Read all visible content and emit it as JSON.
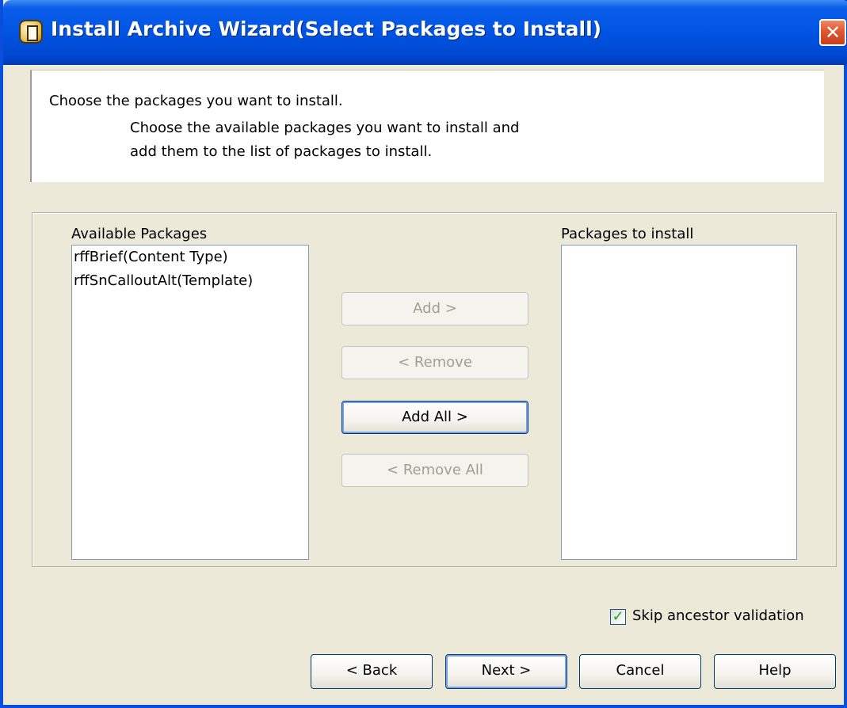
{
  "window": {
    "title": "Install Archive Wizard(Select Packages to Install)"
  },
  "header": {
    "title": "Choose the packages you want to install.",
    "description_lines": [
      "Choose the available packages you want to install and",
      "add them to the list of packages to install."
    ]
  },
  "available": {
    "label": "Available Packages",
    "items": [
      "rffBrief(Content Type)",
      "rffSnCalloutAlt(Template)"
    ]
  },
  "to_install": {
    "label": "Packages to install",
    "items": []
  },
  "transfer_buttons": {
    "add": "Add >",
    "remove": "< Remove",
    "add_all": "Add All >",
    "remove_all": "< Remove All"
  },
  "skip_validation": {
    "label": "Skip ancestor validation",
    "checked": true
  },
  "footer_buttons": {
    "back": "< Back",
    "next": "Next >",
    "cancel": "Cancel",
    "help": "Help"
  },
  "icons": {
    "app": "archive-icon",
    "close": "close-icon",
    "check": "checkmark-icon"
  },
  "colors": {
    "titlebar": "#0054e3",
    "face": "#ece9d8",
    "close": "#df5632",
    "check": "#21a121"
  }
}
